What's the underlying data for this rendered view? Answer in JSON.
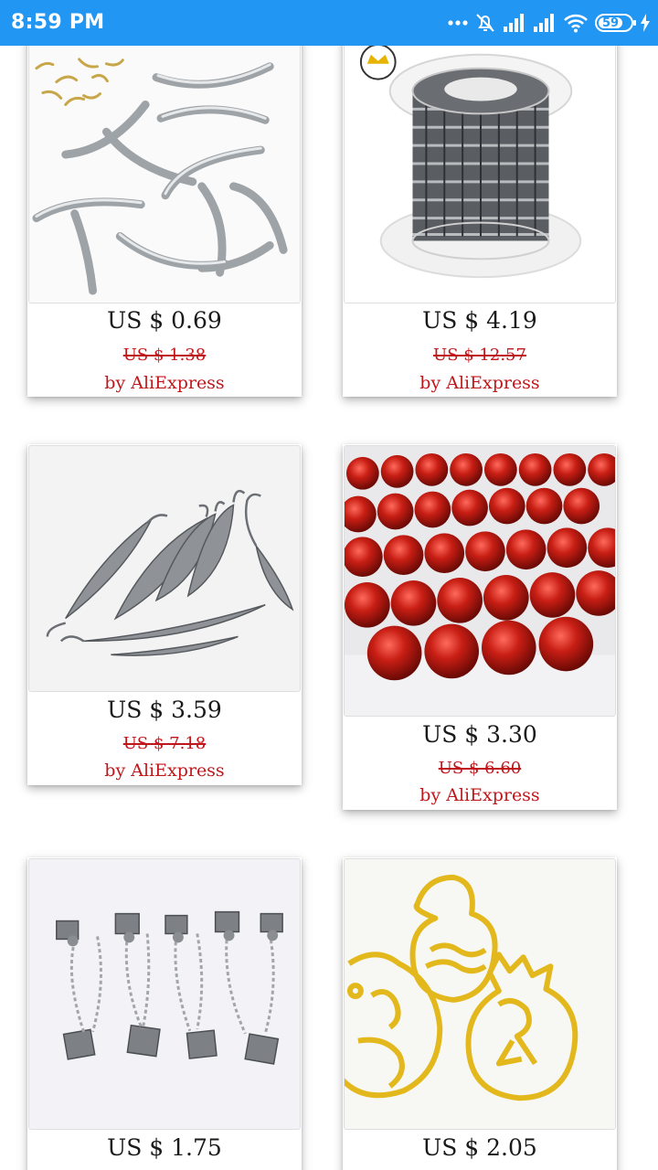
{
  "status_bar": {
    "time": "8:59 PM",
    "battery_level": "59",
    "icons": [
      "dots-icon",
      "muted-alarm-icon",
      "signal-icon",
      "signal-icon",
      "wifi-icon",
      "battery-icon",
      "charging-icon"
    ]
  },
  "colors": {
    "status_bar": "#2196f3",
    "price_text": "#1a1a1a",
    "old_price": "#c0171b",
    "seller": "#c0171b"
  },
  "products": [
    {
      "image": "curved-tube-beads-image",
      "price": "US $ 0.69",
      "old_price": "US $ 1.38",
      "seller": "by AliExpress"
    },
    {
      "image": "chain-spool-image",
      "price": "US $ 4.19",
      "old_price": "US $ 12.57",
      "seller": "by AliExpress"
    },
    {
      "image": "feather-bookmark-image",
      "price": "US $ 3.59",
      "old_price": "US $ 7.18",
      "seller": "by AliExpress"
    },
    {
      "image": "red-glass-beads-image",
      "price": "US $ 3.30",
      "old_price": "US $ 6.60",
      "seller": "by AliExpress"
    },
    {
      "image": "ribbon-end-clasps-image",
      "price": "US $ 1.75"
    },
    {
      "image": "gold-cat-pendant-image",
      "price": "US $ 2.05"
    }
  ]
}
